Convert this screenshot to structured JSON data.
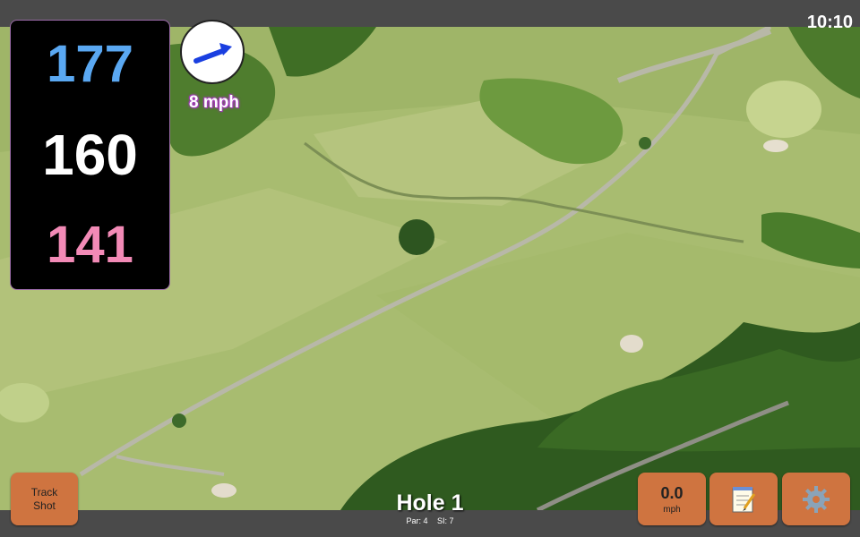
{
  "status": {
    "time": "10:10"
  },
  "distances": {
    "back": "177",
    "center": "160",
    "front": "141"
  },
  "wind": {
    "speed_label": "8 mph",
    "direction_icon": "wind-arrow-icon"
  },
  "hole": {
    "title": "Hole 1",
    "par": "Par: 4",
    "si": "SI: 7"
  },
  "buttons": {
    "track_shot_line1": "Track",
    "track_shot_line2": "Shot",
    "speed_value": "0.0",
    "speed_unit": "mph",
    "notes_icon": "notepad-icon",
    "settings_icon": "gear-icon"
  },
  "colors": {
    "back": "#5aa8f2",
    "center": "#ffffff",
    "front": "#f28ab6",
    "button": "#cf7440",
    "wind_text_outline": "#a23ab8"
  }
}
